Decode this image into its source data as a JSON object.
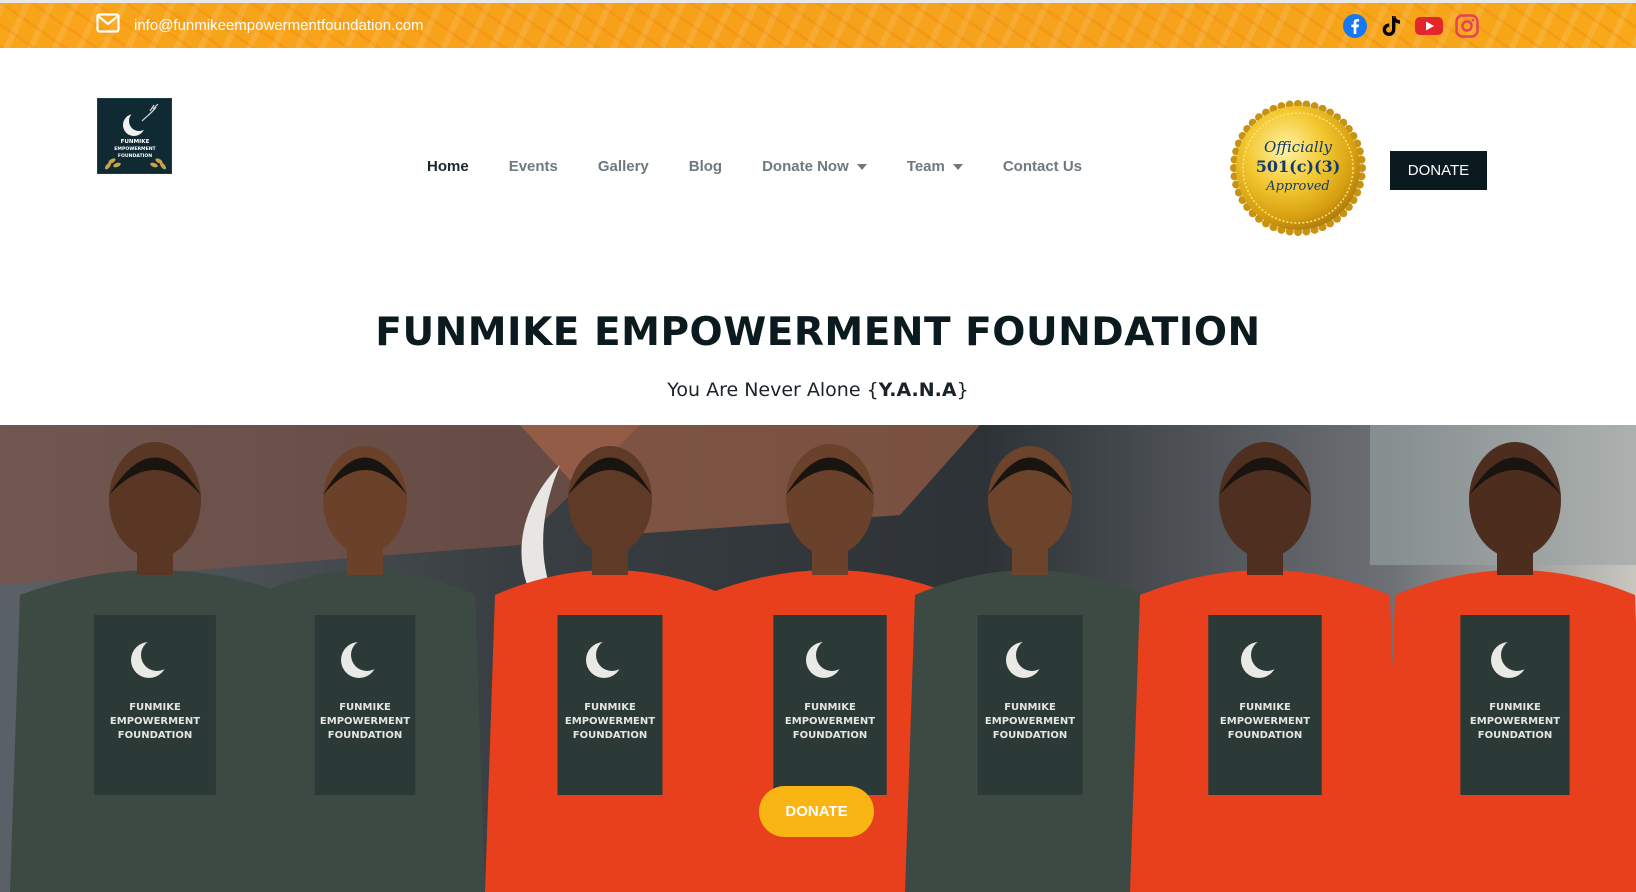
{
  "topbar": {
    "email": "info@funmikeempowermentfoundation.com",
    "email_icon": "envelope-icon",
    "social": [
      {
        "name": "facebook-icon",
        "color": "#1877f2"
      },
      {
        "name": "tiktok-icon",
        "color": "#000000"
      },
      {
        "name": "youtube-icon",
        "color": "#e4262c"
      },
      {
        "name": "instagram-icon",
        "color": "#e4405f"
      }
    ],
    "bg_color": "#f7a31b"
  },
  "header": {
    "logo_text": [
      "FUNMIKE",
      "EMPOWERMENT",
      "FOUNDATION"
    ],
    "nav": [
      {
        "label": "Home",
        "active": true
      },
      {
        "label": "Events"
      },
      {
        "label": "Gallery"
      },
      {
        "label": "Blog"
      },
      {
        "label": "Donate Now",
        "dropdown": true
      },
      {
        "label": "Team",
        "dropdown": true
      },
      {
        "label": "Contact Us"
      }
    ],
    "seal": {
      "line1": "Officially",
      "line2": "501(c)(3)",
      "line3": "Approved"
    },
    "donate_button": "DONATE"
  },
  "hero": {
    "title": "FUNMIKE EMPOWERMENT FOUNDATION",
    "subtitle_prefix": "You Are Never Alone {",
    "subtitle_bold": "Y.A.N.A",
    "subtitle_suffix": "}",
    "cta": "DONATE",
    "shirt_text": [
      "FUNMIKE",
      "EMPOWERMENT",
      "FOUNDATION"
    ]
  },
  "colors": {
    "brand_dark": "#0b1a1f",
    "accent_orange": "#f7a31b",
    "cta_yellow": "#f8b514",
    "shirt_red": "#e8401c",
    "shirt_green": "#3d4a44"
  }
}
